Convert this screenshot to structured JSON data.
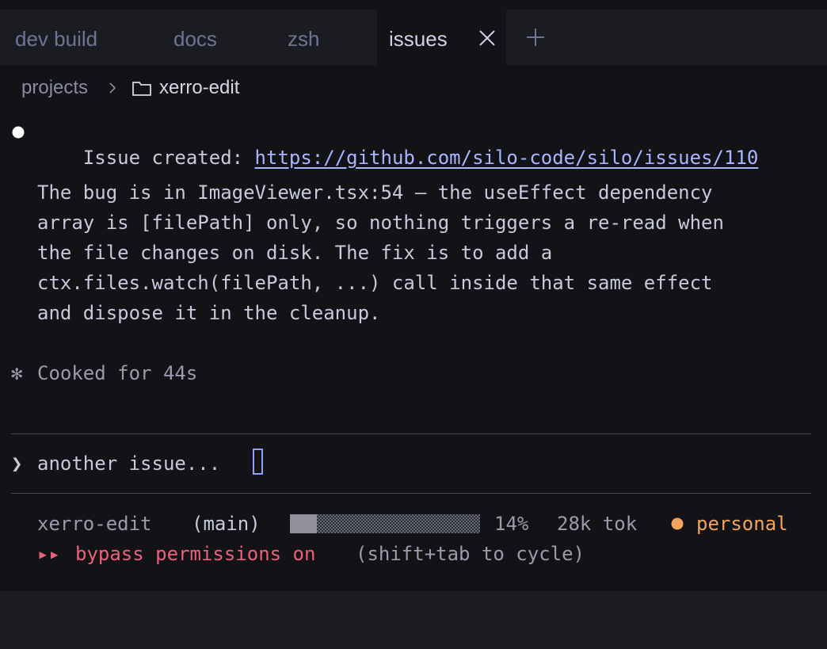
{
  "tabs": [
    {
      "label": "dev build",
      "active": false
    },
    {
      "label": "docs",
      "active": false
    },
    {
      "label": "zsh",
      "active": false
    },
    {
      "label": "issues",
      "active": true
    }
  ],
  "breadcrumb": {
    "root": "projects",
    "folder": "xerro-edit"
  },
  "message": {
    "issue_prefix": "Issue created: ",
    "issue_url": "https://github.com/silo-code/silo/issues/110",
    "body_lines": [
      "The bug is in ImageViewer.tsx:54 — the useEffect dependency",
      "array is [filePath] only, so nothing triggers a re-read when",
      "the file changes on disk. The fix is to add a",
      "ctx.files.watch(filePath, ...) call inside that same effect",
      "and dispose it in the cleanup."
    ]
  },
  "status_cooked": "Cooked for 44s",
  "prompt": {
    "symbol": "❯",
    "text": "another issue..."
  },
  "statusbar": {
    "project": "xerro-edit",
    "branch": "(main)",
    "context_percent": "14%",
    "context_fraction": 0.14,
    "tokens": "28k tok",
    "profile": "personal",
    "mode_arrows": "▸▸",
    "mode_label": "bypass permissions on",
    "mode_hint": "(shift+tab to cycle)"
  },
  "colors": {
    "accent": "#a9b6ff",
    "warning": "#ee5f7c",
    "profile": "#f2a45b"
  }
}
